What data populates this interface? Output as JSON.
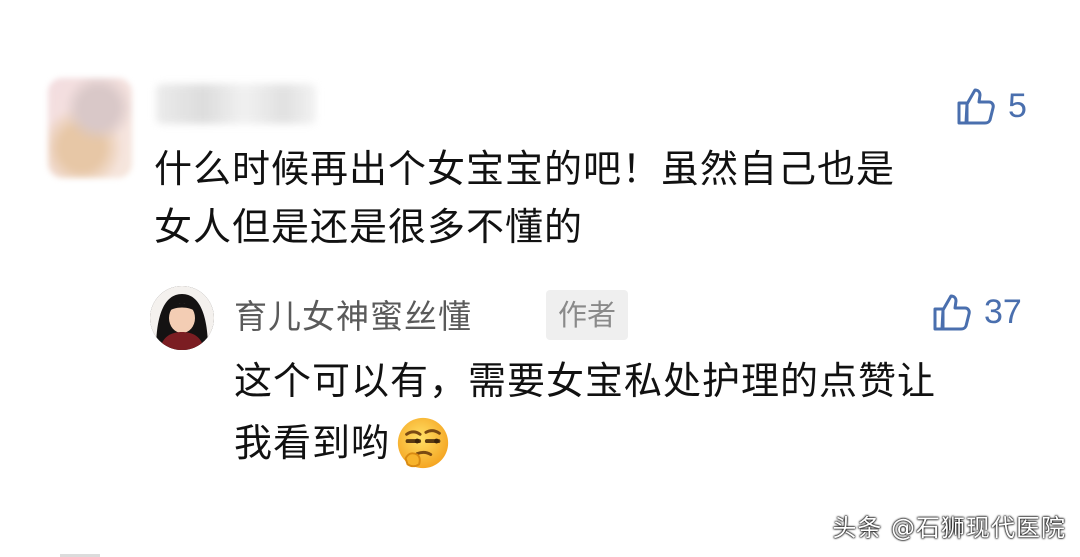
{
  "comment": {
    "likes": "5",
    "lines": [
      "什么时候再出个女宝宝的吧！虽然自己也是",
      "女人但是还是很多不懂的"
    ]
  },
  "reply": {
    "username": "育儿女神蜜丝懂",
    "badge": "作者",
    "likes": "37",
    "lines": [
      "这个可以有，需要女宝私处护理的点赞让",
      "我看到哟"
    ],
    "emoji_icon": "smirk-emoji-icon"
  },
  "watermark": "头条 @石狮现代医院",
  "colors": {
    "like_blue": "#4a6fae",
    "badge_bg": "#efefef",
    "username_gray": "#5a5a5a"
  }
}
